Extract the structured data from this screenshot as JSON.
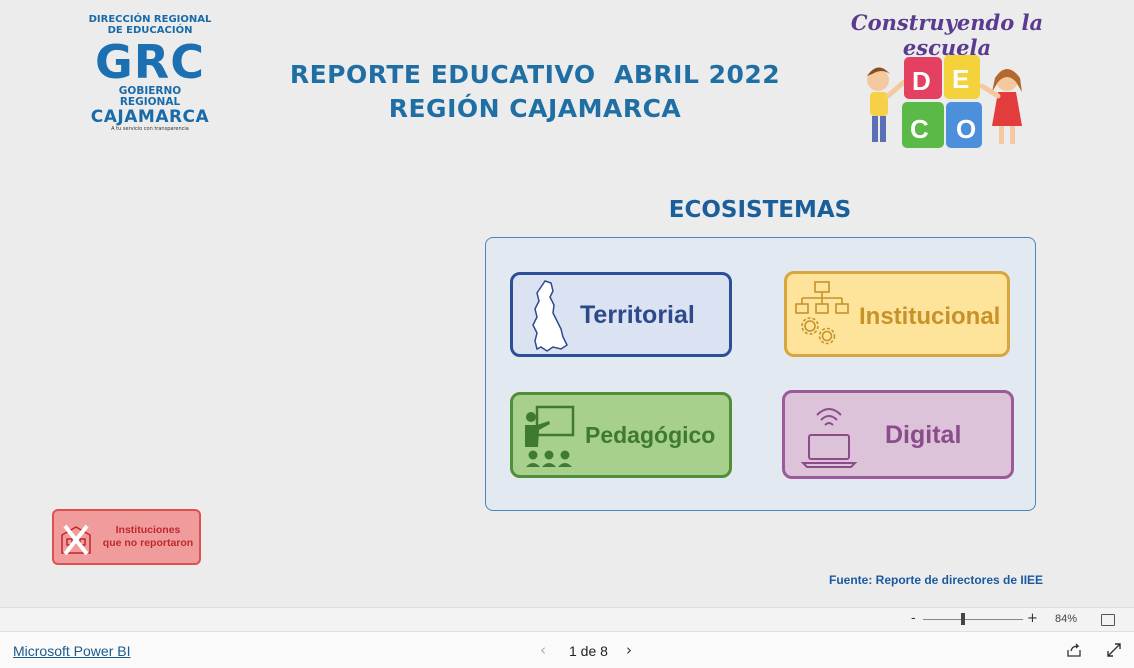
{
  "header": {
    "logo": {
      "line1": "DIRECCIÓN REGIONAL",
      "line2": "DE EDUCACIÓN",
      "mark": "GRC",
      "line3": "GOBIERNO REGIONAL",
      "line4": "CAJAMARCA",
      "tagline": "A tu servicio con transparencia"
    },
    "title_line1": "REPORTE EDUCATIVO  ABRIL 2022",
    "title_line2": "REGIÓN CAJAMARCA",
    "deco_title": "Construyendo la escuela",
    "deco_letters": [
      "D",
      "E",
      "C",
      "O"
    ]
  },
  "ecosystems": {
    "title": "ECOSISTEMAS",
    "items": [
      {
        "label": "Territorial",
        "icon": "map-icon"
      },
      {
        "label": "Institucional",
        "icon": "org-chart-gears-icon"
      },
      {
        "label": "Pedagógico",
        "icon": "teacher-classroom-icon"
      },
      {
        "label": "Digital",
        "icon": "laptop-wifi-icon"
      }
    ]
  },
  "no_report_button": {
    "line1": "Instituciones",
    "line2": "que no reportaron",
    "icon": "crossed-school-icon"
  },
  "source": "Fuente: Reporte de directores de IIEE",
  "zoom": {
    "minus": "-",
    "plus": "+",
    "percent": "84%",
    "level": 0.84
  },
  "footer": {
    "app_link": "Microsoft Power BI",
    "page_indicator": "1 de 8"
  },
  "colors": {
    "title_blue": "#1f6fa5",
    "territorial": "#2d4f9a",
    "institucional": "#d8a640",
    "pedagogico": "#4f8f3a",
    "digital": "#9b5a99",
    "no_report": "#e05050"
  }
}
